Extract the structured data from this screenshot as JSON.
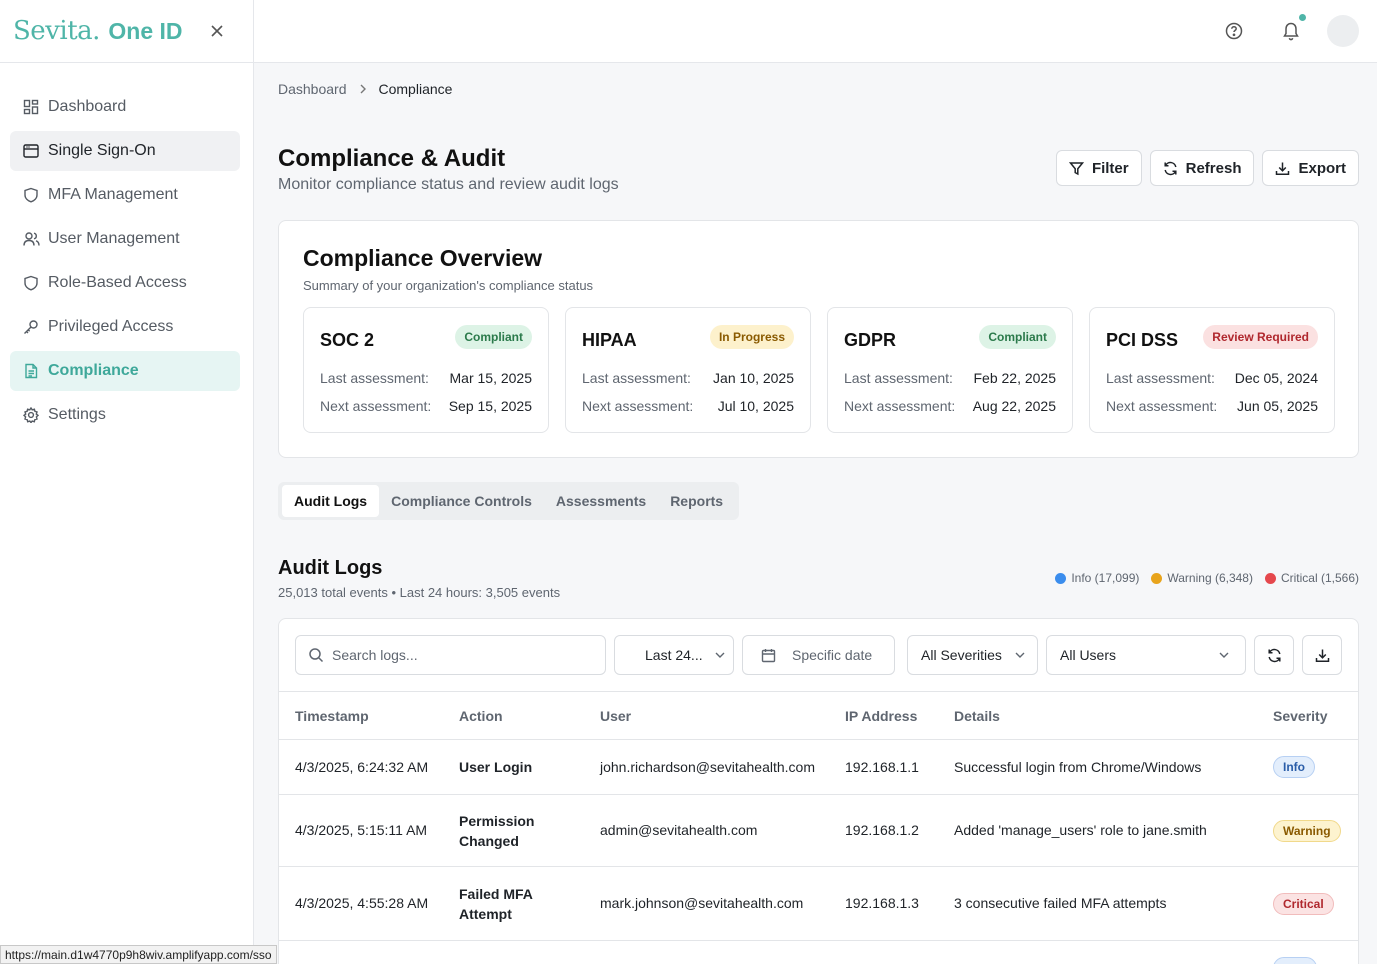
{
  "brand": {
    "logo": "Sevita",
    "dot": ".",
    "product": "One ID"
  },
  "sidebar": {
    "items": [
      {
        "label": "Dashboard",
        "icon": "dashboard-grid-icon",
        "state": ""
      },
      {
        "label": "Single Sign-On",
        "icon": "browser-window-icon",
        "state": "hover"
      },
      {
        "label": "MFA Management",
        "icon": "shield-icon",
        "state": ""
      },
      {
        "label": "User Management",
        "icon": "users-icon",
        "state": ""
      },
      {
        "label": "Role-Based Access",
        "icon": "shield-icon",
        "state": ""
      },
      {
        "label": "Privileged Access",
        "icon": "key-icon",
        "state": ""
      },
      {
        "label": "Compliance",
        "icon": "document-icon",
        "state": "active"
      },
      {
        "label": "Settings",
        "icon": "gear-icon",
        "state": ""
      }
    ]
  },
  "status_url": "https://main.d1w4770p9h8wiv.amplifyapp.com/sso",
  "breadcrumb": {
    "home": "Dashboard",
    "current": "Compliance"
  },
  "page": {
    "title": "Compliance & Audit",
    "subtitle": "Monitor compliance status and review audit logs"
  },
  "actions": {
    "filter": "Filter",
    "refresh": "Refresh",
    "export": "Export"
  },
  "overview": {
    "title": "Compliance Overview",
    "subtitle": "Summary of your organization's compliance status",
    "last_label": "Last assessment:",
    "next_label": "Next assessment:",
    "cards": [
      {
        "name": "SOC 2",
        "status": "Compliant",
        "tone": "green",
        "last": "Mar 15, 2025",
        "next": "Sep 15, 2025"
      },
      {
        "name": "HIPAA",
        "status": "In Progress",
        "tone": "yellow",
        "last": "Jan 10, 2025",
        "next": "Jul 10, 2025"
      },
      {
        "name": "GDPR",
        "status": "Compliant",
        "tone": "green",
        "last": "Feb 22, 2025",
        "next": "Aug 22, 2025"
      },
      {
        "name": "PCI DSS",
        "status": "Review Required",
        "tone": "red",
        "last": "Dec 05, 2024",
        "next": "Jun 05, 2025"
      }
    ]
  },
  "tabs": [
    "Audit Logs",
    "Compliance Controls",
    "Assessments",
    "Reports"
  ],
  "audit": {
    "title": "Audit Logs",
    "subtitle": "25,013 total events • Last 24 hours: 3,505 events",
    "legend": [
      {
        "label": "Info (17,099)",
        "color": "#3b8ded"
      },
      {
        "label": "Warning (6,348)",
        "color": "#e8a41c"
      },
      {
        "label": "Critical (1,566)",
        "color": "#e5484d"
      }
    ],
    "filters": {
      "search_placeholder": "Search logs...",
      "range": "Last 24...",
      "date_placeholder": "Specific date",
      "severity": "All Severities",
      "users": "All Users"
    },
    "columns": [
      "Timestamp",
      "Action",
      "User",
      "IP Address",
      "Details",
      "Severity"
    ],
    "rows": [
      {
        "timestamp": "4/3/2025, 6:24:32 AM",
        "action": "User Login",
        "user": "john.richardson@sevitahealth.com",
        "ip": "192.168.1.1",
        "details": "Successful login from Chrome/Windows",
        "severity": "Info"
      },
      {
        "timestamp": "4/3/2025, 5:15:11 AM",
        "action": "Permission Changed",
        "user": "admin@sevitahealth.com",
        "ip": "192.168.1.2",
        "details": "Added 'manage_users' role to jane.smith",
        "severity": "Warning"
      },
      {
        "timestamp": "4/3/2025, 4:55:28 AM",
        "action": "Failed MFA Attempt",
        "user": "mark.johnson@sevitahealth.com",
        "ip": "192.168.1.3",
        "details": "3 consecutive failed MFA attempts",
        "severity": "Critical"
      }
    ]
  }
}
